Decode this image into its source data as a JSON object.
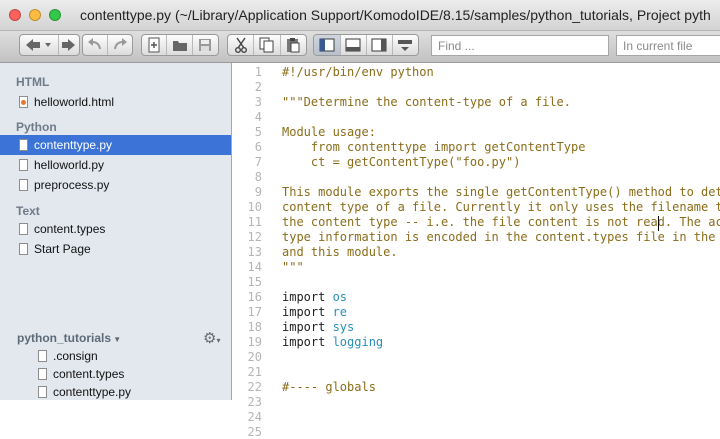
{
  "window": {
    "title": "contenttype.py (~/Library/Application Support/KomodoIDE/8.15/samples/python_tutorials, Project pyth",
    "traffic_light_colors": [
      "#fc605c",
      "#fdbc40",
      "#34c84a"
    ]
  },
  "toolbar": {
    "find_placeholder": "Find ...",
    "find_scope": "In current file",
    "icons": [
      "back-icon",
      "forward-icon",
      "undo-icon",
      "redo-icon",
      "new-file-icon",
      "open-folder-icon",
      "save-icon",
      "cut-icon",
      "copy-icon",
      "paste-icon",
      "left-pane-icon",
      "bottom-pane-icon",
      "right-pane-icon",
      "fullscreen-icon"
    ]
  },
  "sidebar": {
    "sections": [
      {
        "label": "HTML",
        "items": [
          {
            "label": "helloworld.html"
          }
        ]
      },
      {
        "label": "Python",
        "items": [
          {
            "label": "contenttype.py"
          },
          {
            "label": "helloworld.py"
          },
          {
            "label": "preprocess.py"
          }
        ]
      },
      {
        "label": "Text",
        "items": [
          {
            "label": "content.types"
          },
          {
            "label": "Start Page"
          }
        ]
      }
    ],
    "project": {
      "name": "python_tutorials",
      "files": [
        {
          "label": ".consign"
        },
        {
          "label": "content.types"
        },
        {
          "label": "contenttype.py"
        }
      ]
    },
    "selection_color": "#3c73d6"
  },
  "editor": {
    "line_numbers": [
      "1",
      "2",
      "3",
      "4",
      "5",
      "6",
      "7",
      "8",
      "9",
      "10",
      "11",
      "12",
      "13",
      "14",
      "15",
      "16",
      "17",
      "18",
      "19",
      "20",
      "21",
      "22",
      "23",
      "24",
      "25"
    ],
    "lines": [
      "#!/usr/bin/env python",
      "",
      "\"\"\"Determine the content-type of a file.",
      "",
      "Module usage:",
      "    from contenttype import getContentType",
      "    ct = getContentType(\"foo.py\")",
      "",
      "This module exports the single getContentType() method to det",
      "content type of a file. Currently it only uses the filename t",
      "the content type -- i.e. the file content is not read. The ac",
      "type information is encoded in the content.types file in the ",
      "and this module.",
      "\"\"\"",
      "",
      "import os",
      "import re",
      "import sys",
      "import logging",
      "",
      "",
      "#---- globals"
    ],
    "colors": {
      "docstring": "#8a6d1a",
      "module": "#2a8fb8",
      "comment": "#8a8a8a"
    }
  }
}
